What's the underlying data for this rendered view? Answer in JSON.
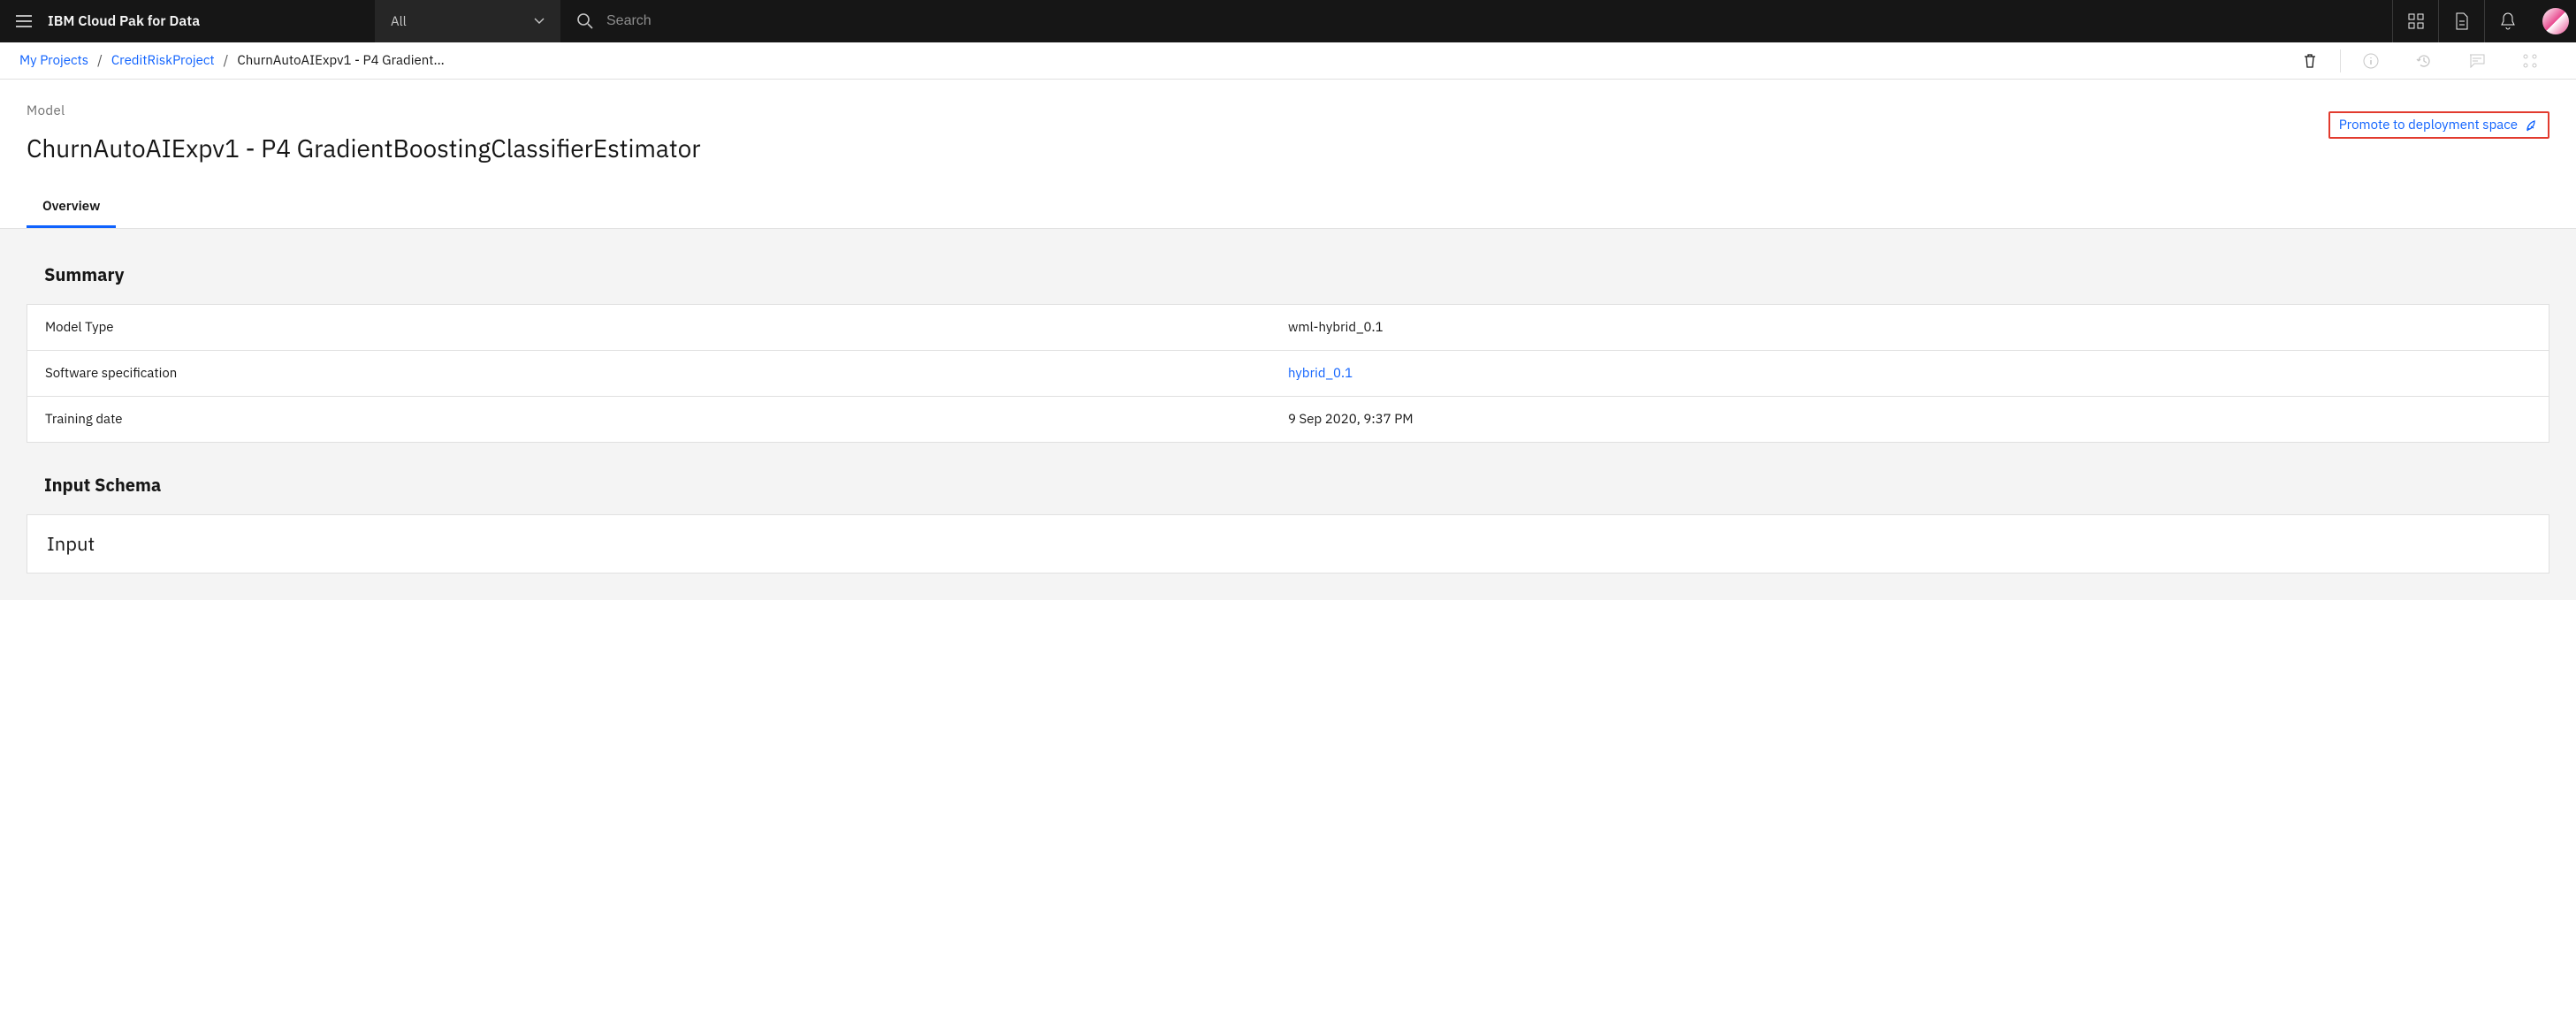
{
  "header": {
    "brand": "IBM Cloud Pak for Data",
    "scope": "All",
    "searchPlaceholder": "Search"
  },
  "breadcrumb": {
    "root": "My Projects",
    "project": "CreditRiskProject",
    "current": "ChurnAutoAIExpv1 - P4 Gradient..."
  },
  "page": {
    "sectionLabel": "Model",
    "title": "ChurnAutoAIExpv1 - P4 GradientBoostingClassifierEstimator",
    "promoteLabel": "Promote to deployment space"
  },
  "tabs": {
    "overview": "Overview"
  },
  "summary": {
    "heading": "Summary",
    "rows": {
      "modelType": {
        "label": "Model Type",
        "value": "wml-hybrid_0.1"
      },
      "softwareSpec": {
        "label": "Software specification",
        "value": "hybrid_0.1"
      },
      "trainingDate": {
        "label": "Training date",
        "value": "9 Sep 2020, 9:37 PM"
      }
    }
  },
  "inputSchema": {
    "heading": "Input Schema",
    "cardTitle": "Input"
  }
}
